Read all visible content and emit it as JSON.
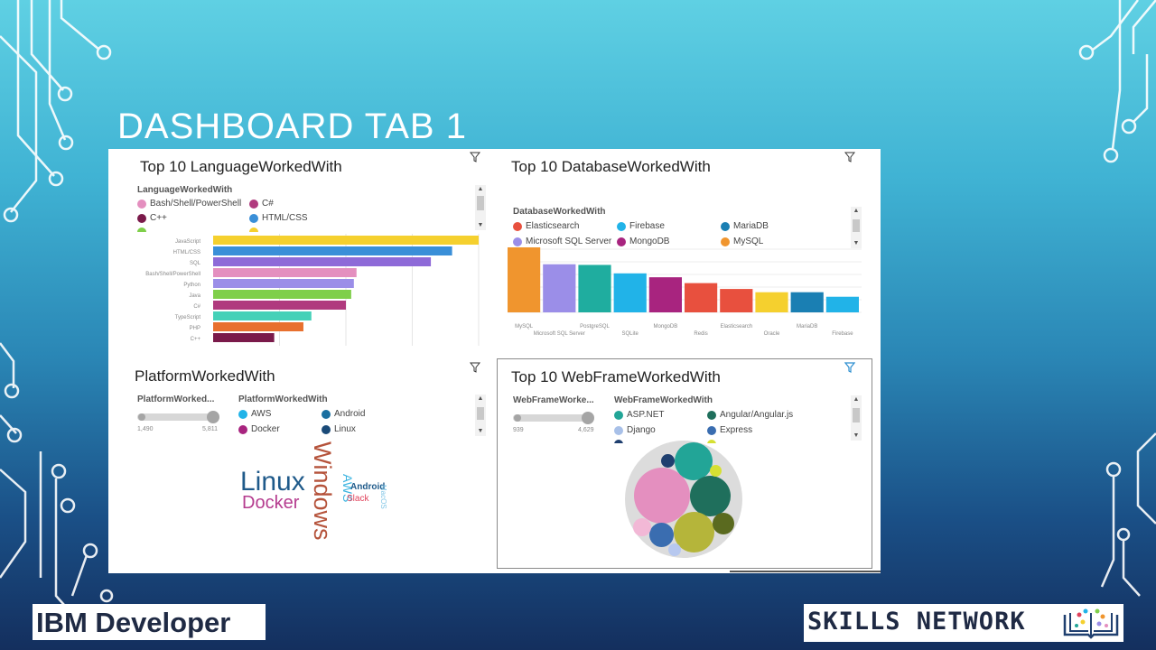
{
  "slide": {
    "title": "DASHBOARD TAB 1"
  },
  "colors": {
    "bg_top": "#5fd0e3",
    "bg_bottom": "#142f5e",
    "circuit": "#ffffff"
  },
  "language_panel": {
    "title": "Top 10 LanguageWorkedWith",
    "legend_title": "LanguageWorkedWith",
    "legend": [
      {
        "label": "Bash/Shell/PowerShell",
        "color": "#e48fbf"
      },
      {
        "label": "C#",
        "color": "#b03a7e"
      },
      {
        "label": "C++",
        "color": "#7a1a4a"
      },
      {
        "label": "HTML/CSS",
        "color": "#3a8fd8"
      }
    ]
  },
  "database_panel": {
    "title": "Top 10 DatabaseWorkedWith",
    "legend_title": "DatabaseWorkedWith",
    "legend": [
      {
        "label": "Elasticsearch",
        "color": "#e8503e"
      },
      {
        "label": "Firebase",
        "color": "#21b3e8"
      },
      {
        "label": "MariaDB",
        "color": "#1a7fb3"
      },
      {
        "label": "Microsoft SQL Server",
        "color": "#9b8ee8"
      },
      {
        "label": "MongoDB",
        "color": "#a8247f"
      },
      {
        "label": "MySQL",
        "color": "#f0952e"
      }
    ]
  },
  "platform_panel": {
    "title": "PlatformWorkedWith",
    "slider_label": "PlatformWorked...",
    "slider_min": "1,490",
    "slider_max": "5,811",
    "legend_title": "PlatformWorkedWith",
    "legend": [
      {
        "label": "AWS",
        "color": "#21b3e8"
      },
      {
        "label": "Android",
        "color": "#1a6fa0"
      },
      {
        "label": "Docker",
        "color": "#a8247f"
      },
      {
        "label": "Linux",
        "color": "#1a4a78"
      }
    ],
    "words": [
      {
        "text": "Windows",
        "color": "#b5533b"
      },
      {
        "text": "Linux",
        "color": "#1f5a8a"
      },
      {
        "text": "Docker",
        "color": "#b53c8f"
      },
      {
        "text": "AWS",
        "color": "#39b3e0"
      },
      {
        "text": "Android",
        "color": "#1f5a8a"
      },
      {
        "text": "Slack",
        "color": "#e0415a"
      },
      {
        "text": "MacOS",
        "color": "#7fc5e6"
      }
    ]
  },
  "webframe_panel": {
    "title": "Top 10 WebFrameWorkedWith",
    "slider_label": "WebFrameWorke...",
    "slider_min": "939",
    "slider_max": "4,629",
    "legend_title": "WebFrameWorkedWith",
    "legend": [
      {
        "label": "ASP.NET",
        "color": "#22a597"
      },
      {
        "label": "Angular/Angular.js",
        "color": "#1f6f5c"
      },
      {
        "label": "Django",
        "color": "#a8c0e8"
      },
      {
        "label": "Express",
        "color": "#3a6db0"
      }
    ],
    "bubbles": [
      {
        "name": "large-pink",
        "color": "#e48fbf"
      },
      {
        "name": "teal",
        "color": "#22a597"
      },
      {
        "name": "dark-green",
        "color": "#1f6f5c"
      },
      {
        "name": "olive",
        "color": "#b5b53a"
      },
      {
        "name": "dark-olive",
        "color": "#5a6a1f"
      },
      {
        "name": "blue",
        "color": "#3a6db0"
      },
      {
        "name": "light-pink",
        "color": "#f2b8d6"
      },
      {
        "name": "navy",
        "color": "#1f3f6f"
      },
      {
        "name": "yellow-green",
        "color": "#d6e033"
      },
      {
        "name": "light-blue",
        "color": "#b7c8ef"
      }
    ]
  },
  "chart_data": [
    {
      "type": "bar",
      "orientation": "horizontal",
      "title": "Top 10 LanguageWorkedWith",
      "categories": [
        "JavaScript",
        "HTML/CSS",
        "SQL",
        "Bash/Shell/PowerShell",
        "Python",
        "Java",
        "C#",
        "TypeScript",
        "PHP",
        "C++"
      ],
      "values": [
        100,
        90,
        82,
        54,
        53,
        52,
        50,
        37,
        34,
        23
      ],
      "colors": [
        "#f5d02e",
        "#3a8fd8",
        "#8e6ad8",
        "#e48fbf",
        "#9b8ee8",
        "#7fcf4a",
        "#b03a7e",
        "#45d1b8",
        "#e8702e",
        "#7a1a4a"
      ]
    },
    {
      "type": "bar",
      "title": "Top 10 DatabaseWorkedWith",
      "categories": [
        "MySQL",
        "Microsoft SQL Server",
        "PostgreSQL",
        "SQLite",
        "MongoDB",
        "Redis",
        "Elasticsearch",
        "Oracle",
        "MariaDB",
        "Firebase"
      ],
      "values": [
        100,
        74,
        73,
        60,
        54,
        45,
        36,
        31,
        31,
        24
      ],
      "colors": [
        "#f0952e",
        "#9b8ee8",
        "#1fad9f",
        "#21b3e8",
        "#a8247f",
        "#e8503e",
        "#e8503e",
        "#f5d02e",
        "#1a7fb3",
        "#21b3e8"
      ]
    }
  ]
}
